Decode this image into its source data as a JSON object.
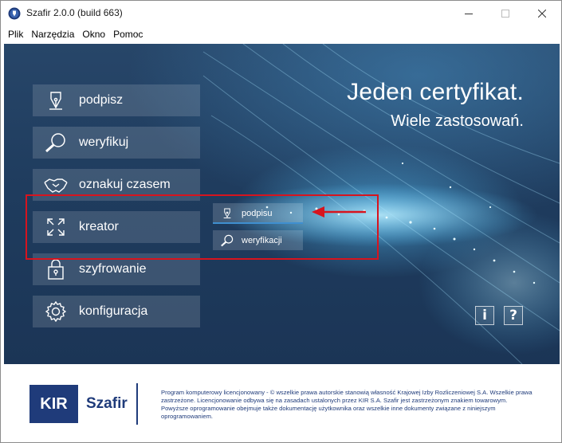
{
  "window": {
    "title": "Szafir 2.0.0 (build 663)",
    "controls": {
      "minimize": "minimize-icon",
      "maximize": "maximize-icon",
      "close": "close-icon"
    }
  },
  "menu": {
    "items": [
      "Plik",
      "Narzędzia",
      "Okno",
      "Pomoc"
    ]
  },
  "main": {
    "slogan_line1": "Jeden certyfikat.",
    "slogan_line2": "Wiele zastosowań.",
    "nav": [
      {
        "label": "podpisz",
        "icon": "pen-nib-icon"
      },
      {
        "label": "weryfikuj",
        "icon": "magnifier-icon"
      },
      {
        "label": "oznakuj czasem",
        "icon": "handshake-icon"
      },
      {
        "label": "kreator",
        "icon": "expand-arrows-icon"
      },
      {
        "label": "szyfrowanie",
        "icon": "padlock-icon"
      },
      {
        "label": "konfiguracja",
        "icon": "gear-icon"
      }
    ],
    "kreator_submenu": [
      {
        "label": "podpisu",
        "icon": "pen-nib-icon",
        "selected": true
      },
      {
        "label": "weryfikacji",
        "icon": "magnifier-icon",
        "selected": false
      }
    ],
    "info_button": "i",
    "help_button": "?"
  },
  "annotation": {
    "color": "#d7141e"
  },
  "footer": {
    "logo_text": "KIR",
    "brand_text": "Szafir",
    "legal_text": "Program komputerowy licencjonowany - © wszelkie prawa autorskie stanowią własność Krajowej Izby Rozliczeniowej S.A. Wszelkie prawa zastrzeżone. Licencjonowanie odbywa się na zasadach ustalonych przez KIR S.A. Szafir jest zastrzeżonym znakiem towarowym. Powyższe oprogramowanie obejmuje także dokumentację użytkownika oraz wszelkie inne dokumenty związane z niniejszym oprogramowaniem."
  },
  "colors": {
    "panel": "#1f3c5e",
    "brand": "#1f3b7a",
    "accent": "#3f8fd0",
    "highlight": "#d7141e"
  }
}
